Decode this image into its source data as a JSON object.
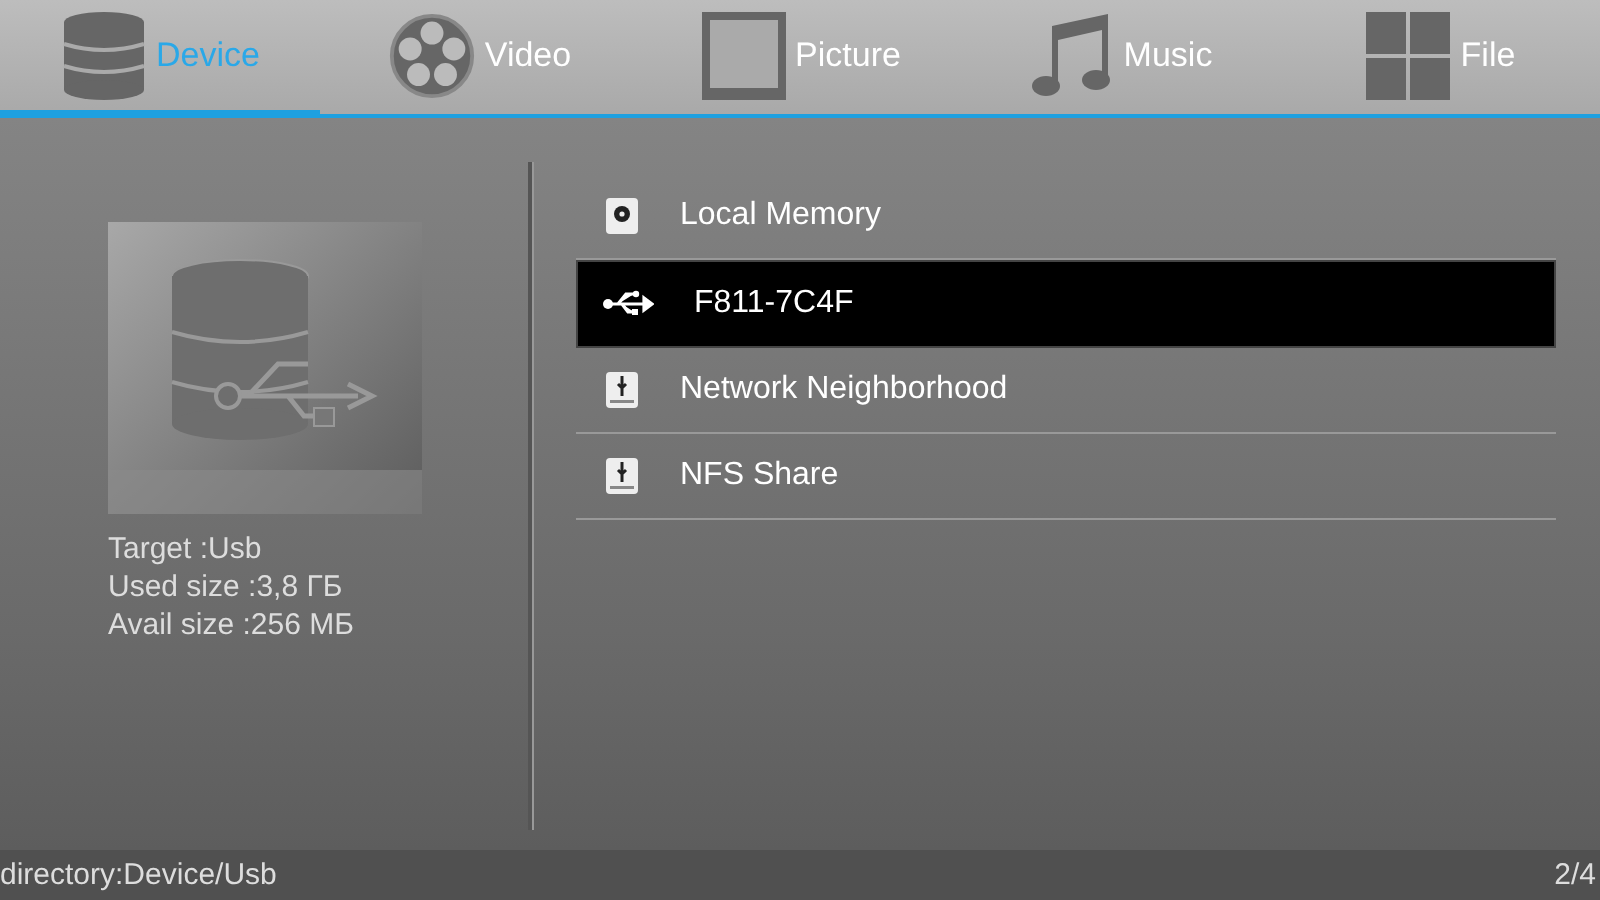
{
  "tabs": [
    {
      "label": "Device",
      "kind": "device",
      "selected": true
    },
    {
      "label": "Video",
      "kind": "video",
      "selected": false
    },
    {
      "label": "Picture",
      "kind": "picture",
      "selected": false
    },
    {
      "label": "Music",
      "kind": "music",
      "selected": false
    },
    {
      "label": "File",
      "kind": "file",
      "selected": false
    }
  ],
  "info": {
    "lines": [
      "Target :Usb",
      "Used size :3,8 ГБ",
      "Avail size :256 МБ"
    ]
  },
  "devices": [
    {
      "label": "Local Memory",
      "kind": "disk",
      "selected": false
    },
    {
      "label": "F811-7C4F",
      "kind": "usb",
      "selected": true
    },
    {
      "label": "Network Neighborhood",
      "kind": "share",
      "selected": false
    },
    {
      "label": "NFS Share",
      "kind": "share",
      "selected": false
    }
  ],
  "status_bar": {
    "path": "directory:Device/Usb",
    "page": "2/4"
  }
}
